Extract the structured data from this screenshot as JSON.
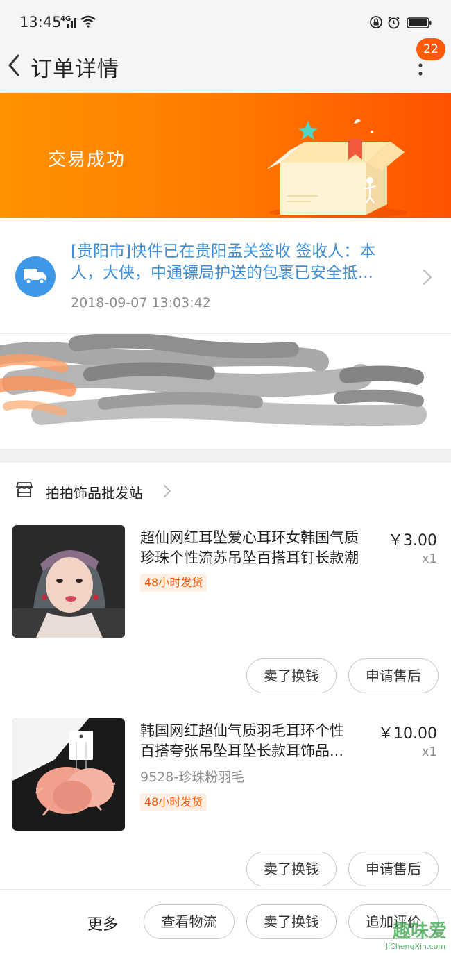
{
  "status_bar": {
    "time": "13:45",
    "network": "4G"
  },
  "nav": {
    "title": "订单详情",
    "badge_count": "22"
  },
  "banner": {
    "status": "交易成功"
  },
  "logistics": {
    "line1": "[贵阳市]快件已在贵阳孟关签收 签收人：本",
    "line2": "人，大侠，中通镖局护送的包裹已安全抵...",
    "time": "2018-09-07 13:03:42"
  },
  "shop": {
    "name": "拍拍饰品批发站"
  },
  "items": [
    {
      "name_line1": "超仙网红耳坠爱心耳环女韩国气质",
      "name_line2": "珍珠个性流苏吊坠百搭耳钉长款潮",
      "price": "￥3.00",
      "qty": "x1",
      "sku": "",
      "tag": "48小时发货",
      "btn_sell": "卖了换钱",
      "btn_after_sale": "申请售后"
    },
    {
      "name_line1": "韩国网红超仙气质羽毛耳环个性",
      "name_line2": "百搭夸张吊坠耳坠长款耳饰品...",
      "price": "￥10.00",
      "qty": "x1",
      "sku": "9528-珍珠粉羽毛",
      "tag": "48小时发货",
      "btn_sell": "卖了换钱",
      "btn_after_sale": "申请售后"
    }
  ],
  "bottom_bar": {
    "more": "更多",
    "view_logistics": "查看物流",
    "sell": "卖了换钱",
    "add_review": "追加评价"
  },
  "watermark": {
    "text": "趣味爱",
    "sub": "JiChengXin.com"
  },
  "colors": {
    "accent": "#ff5a0a",
    "link": "#3f8fd8",
    "banner_start": "#ff9200",
    "banner_end": "#ff5200"
  }
}
